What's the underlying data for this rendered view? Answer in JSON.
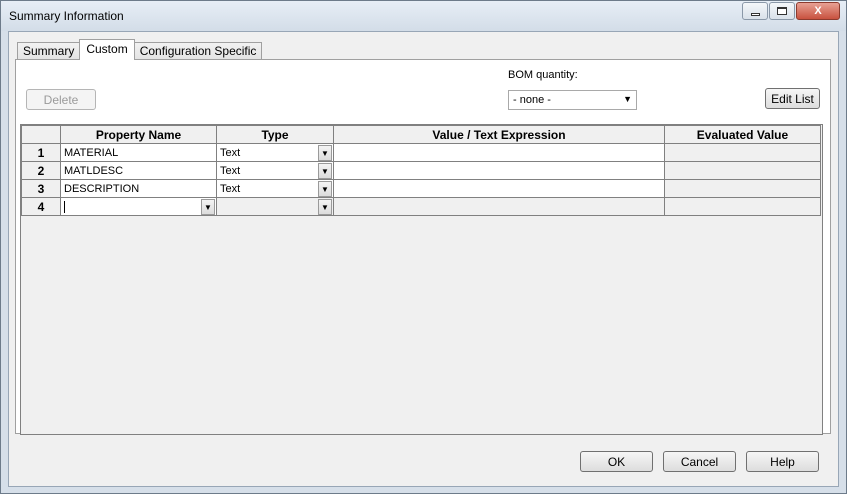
{
  "window": {
    "title": "Summary Information",
    "minimize_label": "",
    "maximize_label": "",
    "close_label": "X"
  },
  "tabs": [
    {
      "label": "Summary",
      "active": false
    },
    {
      "label": "Custom",
      "active": true
    },
    {
      "label": "Configuration Specific",
      "active": false
    }
  ],
  "toolbar": {
    "delete_label": "Delete",
    "bom_label": "BOM quantity:",
    "bom_value": "- none -",
    "edit_list_label": "Edit List"
  },
  "grid": {
    "columns": [
      "",
      "Property Name",
      "Type",
      "Value / Text Expression",
      "Evaluated Value"
    ],
    "rows": [
      {
        "num": "1",
        "name": "MATERIAL",
        "type": "Text",
        "value": "",
        "evaluated": ""
      },
      {
        "num": "2",
        "name": "MATLDESC",
        "type": "Text",
        "value": "",
        "evaluated": ""
      },
      {
        "num": "3",
        "name": "DESCRIPTION",
        "type": "Text",
        "value": "",
        "evaluated": ""
      },
      {
        "num": "4",
        "name": "",
        "type": "",
        "value": "",
        "evaluated": ""
      }
    ]
  },
  "footer": {
    "ok_label": "OK",
    "cancel_label": "Cancel",
    "help_label": "Help"
  }
}
